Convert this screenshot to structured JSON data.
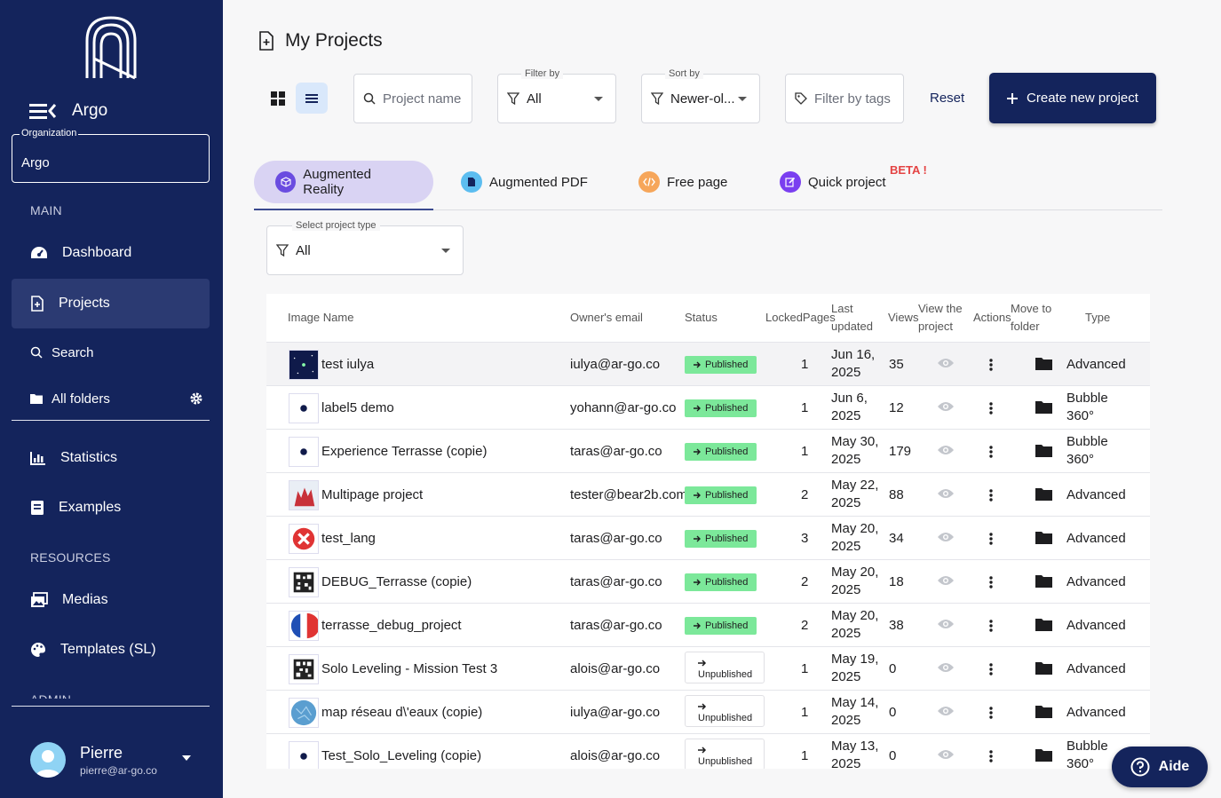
{
  "sidebar": {
    "brand": "Argo",
    "org_legend": "Organization",
    "org_value": "Argo",
    "main_label": "MAIN",
    "resources_label": "RESOURCES",
    "admin_label": "ADMIN",
    "dashboard": "Dashboard",
    "projects": "Projects",
    "search": "Search",
    "all_folders": "All folders",
    "statistics": "Statistics",
    "examples": "Examples",
    "medias": "Medias",
    "templates": "Templates (SL)",
    "user_name": "Pierre",
    "user_email": "pierre@ar-go.co"
  },
  "header": {
    "title": "My Projects"
  },
  "filters": {
    "project_name_placeholder": "Project name",
    "filter_by_legend": "Filter by",
    "filter_by_value": "All",
    "sort_by_legend": "Sort by",
    "sort_by_value": "Newer-ol...",
    "tags_placeholder": "Filter by tags",
    "reset": "Reset",
    "create": "Create new project"
  },
  "tabs": {
    "ar": "Augmented Reality",
    "pdf": "Augmented PDF",
    "free": "Free page",
    "quick": "Quick project",
    "beta": "BETA !"
  },
  "type_select": {
    "legend": "Select project type",
    "value": "All"
  },
  "table": {
    "headers": {
      "image_name": "Image Name",
      "owner": "Owner's email",
      "status": "Status",
      "locked": "LockedPages",
      "updated_1": "Last",
      "updated_2": "updated",
      "views": "Views",
      "view_1": "View the",
      "view_2": "project",
      "actions": "Actions",
      "move_1": "Move to",
      "move_2": "folder",
      "type": "Type"
    },
    "rows": [
      {
        "name": "test iulya",
        "owner": "iulya@ar-go.co",
        "status": "Published",
        "locked": "1",
        "date1": "Jun 16,",
        "date2": "2025",
        "views": "35",
        "type1": "Advanced",
        "type2": ""
      },
      {
        "name": "label5 demo",
        "owner": "yohann@ar-go.co",
        "status": "Published",
        "locked": "1",
        "date1": "Jun 6,",
        "date2": "2025",
        "views": "12",
        "type1": "Bubble",
        "type2": "360°"
      },
      {
        "name": "Experience Terrasse (copie)",
        "owner": "taras@ar-go.co",
        "status": "Published",
        "locked": "1",
        "date1": "May 30,",
        "date2": "2025",
        "views": "179",
        "type1": "Bubble",
        "type2": "360°"
      },
      {
        "name": "Multipage project",
        "owner": "tester@bear2b.com",
        "status": "Published",
        "locked": "2",
        "date1": "May 22,",
        "date2": "2025",
        "views": "88",
        "type1": "Advanced",
        "type2": ""
      },
      {
        "name": "test_lang",
        "owner": "taras@ar-go.co",
        "status": "Published",
        "locked": "3",
        "date1": "May 20,",
        "date2": "2025",
        "views": "34",
        "type1": "Advanced",
        "type2": ""
      },
      {
        "name": "DEBUG_Terrasse (copie)",
        "owner": "taras@ar-go.co",
        "status": "Published",
        "locked": "2",
        "date1": "May 20,",
        "date2": "2025",
        "views": "18",
        "type1": "Advanced",
        "type2": ""
      },
      {
        "name": "terrasse_debug_project",
        "owner": "taras@ar-go.co",
        "status": "Published",
        "locked": "2",
        "date1": "May 20,",
        "date2": "2025",
        "views": "38",
        "type1": "Advanced",
        "type2": ""
      },
      {
        "name": "Solo Leveling - Mission Test 3",
        "owner": "alois@ar-go.co",
        "status": "Unpublished",
        "locked": "1",
        "date1": "May 19,",
        "date2": "2025",
        "views": "0",
        "type1": "Advanced",
        "type2": ""
      },
      {
        "name": "map réseau d\\'eaux (copie)",
        "owner": "iulya@ar-go.co",
        "status": "Unpublished",
        "locked": "1",
        "date1": "May 14,",
        "date2": "2025",
        "views": "0",
        "type1": "Advanced",
        "type2": ""
      },
      {
        "name": "Test_Solo_Leveling (copie)",
        "owner": "alois@ar-go.co",
        "status": "Unpublished",
        "locked": "1",
        "date1": "May 13,",
        "date2": "2025",
        "views": "0",
        "type1": "Bubble",
        "type2": "360°"
      }
    ]
  },
  "help": {
    "label": "Aide"
  }
}
